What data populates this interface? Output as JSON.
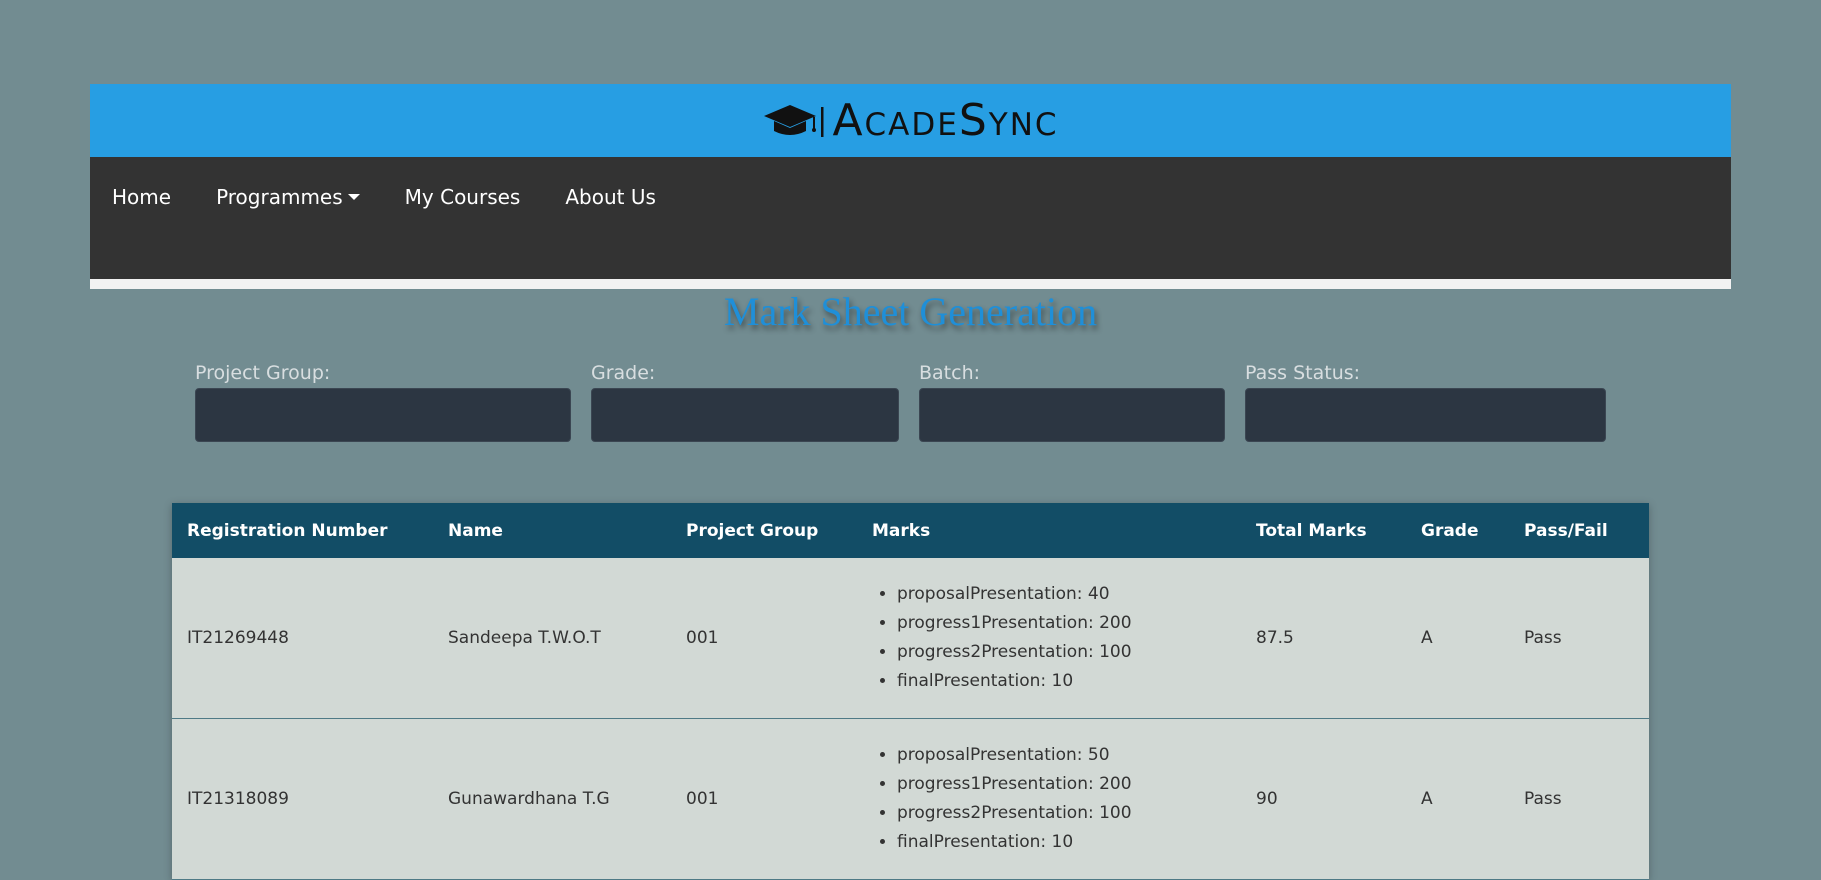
{
  "app": {
    "brand_name": "AcadeSync",
    "colors": {
      "background": "#728c91",
      "brand_bar": "#279ee3",
      "nav_bar": "#333333",
      "table_header": "#124d66",
      "row_background": "#d2d9d5",
      "title": "#1f8fd8"
    }
  },
  "nav": {
    "items": [
      {
        "label": "Home"
      },
      {
        "label": "Programmes",
        "has_dropdown": true
      },
      {
        "label": "My Courses"
      },
      {
        "label": "About Us"
      }
    ]
  },
  "page": {
    "title": "Mark Sheet Generation"
  },
  "filters": [
    {
      "label": "Project Group:",
      "value": ""
    },
    {
      "label": "Grade:",
      "value": ""
    },
    {
      "label": "Batch:",
      "value": ""
    },
    {
      "label": "Pass Status:",
      "value": ""
    }
  ],
  "table": {
    "headers": [
      "Registration Number",
      "Name",
      "Project Group",
      "Marks",
      "Total Marks",
      "Grade",
      "Pass/Fail"
    ],
    "rows": [
      {
        "reg": "IT21269448",
        "name": "Sandeepa T.W.O.T",
        "group": "001",
        "marks": [
          "proposalPresentation: 40",
          "progress1Presentation: 200",
          "progress2Presentation: 100",
          "finalPresentation: 10"
        ],
        "total": "87.5",
        "grade": "A",
        "status": "Pass"
      },
      {
        "reg": "IT21318089",
        "name": "Gunawardhana T.G",
        "group": "001",
        "marks": [
          "proposalPresentation: 50",
          "progress1Presentation: 200",
          "progress2Presentation: 100",
          "finalPresentation: 10"
        ],
        "total": "90",
        "grade": "A",
        "status": "Pass"
      }
    ]
  }
}
